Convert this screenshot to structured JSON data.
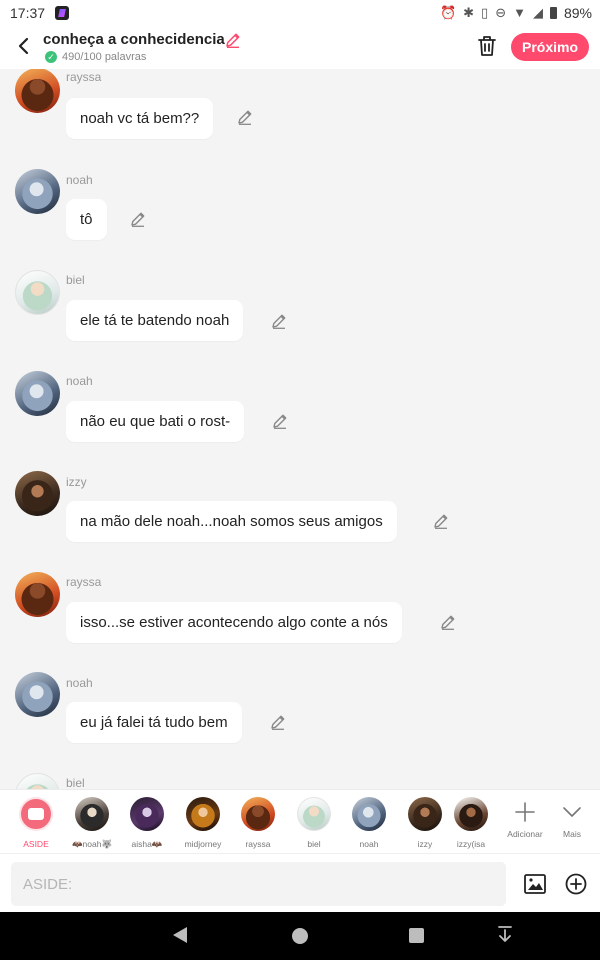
{
  "status_bar": {
    "time": "17:37",
    "battery": "89%",
    "icons": [
      "alarm-icon",
      "bluetooth-icon",
      "vibrate-icon",
      "dnd-icon",
      "wifi-icon",
      "signal-icon",
      "battery-icon"
    ]
  },
  "header": {
    "title": "conheça a conhecidencia",
    "word_count": "490/100 palavras",
    "next_label": "Próximo",
    "accent_color": "#ff4a6e"
  },
  "messages": [
    {
      "sender": "rayssa",
      "text": "noah vc tá bem??"
    },
    {
      "sender": "noah",
      "text": "tô"
    },
    {
      "sender": "biel",
      "text": "ele tá te batendo noah"
    },
    {
      "sender": "noah",
      "text": "não eu que bati o rost-"
    },
    {
      "sender": "izzy",
      "text": "na mão dele noah...noah somos seus amigos"
    },
    {
      "sender": "rayssa",
      "text": "isso...se estiver acontecendo algo conte a nós"
    },
    {
      "sender": "noah",
      "text": "eu já falei tá tudo bem"
    },
    {
      "sender": "biel",
      "text": ""
    }
  ],
  "characters": [
    {
      "label": "ASIDE"
    },
    {
      "label": "🦇noah🐺"
    },
    {
      "label": "aisha🦇"
    },
    {
      "label": "midjorney"
    },
    {
      "label": "rayssa"
    },
    {
      "label": "biel"
    },
    {
      "label": "noah"
    },
    {
      "label": "izzy"
    },
    {
      "label": "izzy(isa"
    }
  ],
  "tools": {
    "add_label": "Adicionar",
    "more_label": "Mais"
  },
  "input": {
    "placeholder": "ASIDE:",
    "value": ""
  }
}
